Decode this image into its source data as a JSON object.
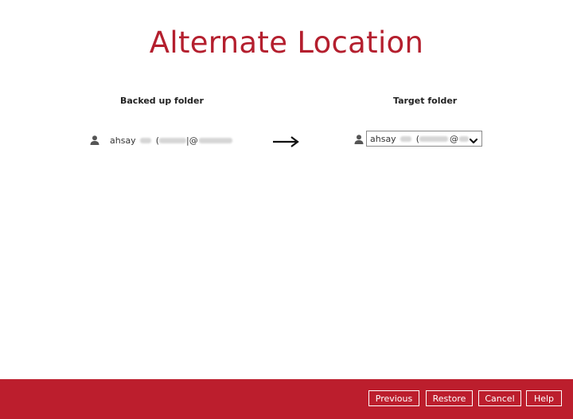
{
  "page": {
    "title": "Alternate Location"
  },
  "columns": {
    "left_header": "Backed up folder",
    "right_header": "Target folder"
  },
  "source": {
    "icon": "user-icon",
    "account_prefix": "ahsay",
    "account_paren": "(",
    "account_at": "|@"
  },
  "target": {
    "icon": "user-icon",
    "selected_prefix": "ahsay",
    "selected_paren": "(",
    "selected_at": "@",
    "dropdown_icon": "chevron-down-icon"
  },
  "footer": {
    "background": "#bc1e2d",
    "buttons": {
      "previous": "Previous",
      "restore": "Restore",
      "cancel": "Cancel",
      "help": "Help"
    }
  },
  "colors": {
    "accent": "#b41f2e"
  }
}
